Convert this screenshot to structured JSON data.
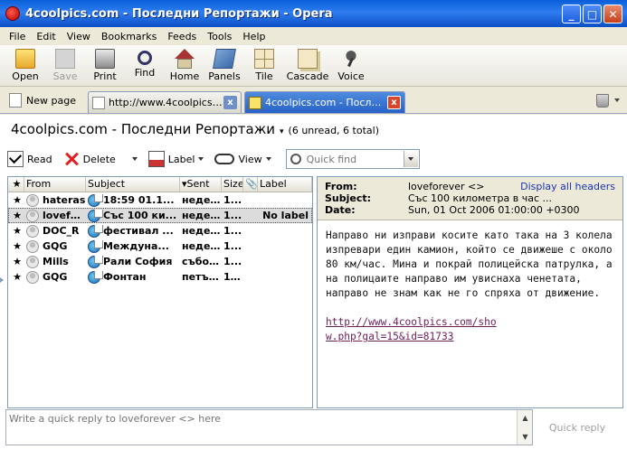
{
  "window": {
    "title": "4coolpics.com - Последни Репортажи - Opera",
    "controls": {
      "minimize": "_",
      "maximize": "□",
      "close": "✕"
    }
  },
  "menu": [
    "File",
    "Edit",
    "View",
    "Bookmarks",
    "Feeds",
    "Tools",
    "Help"
  ],
  "toolbar": {
    "open": "Open",
    "save": "Save",
    "print": "Print",
    "find": "Find",
    "home": "Home",
    "panels": "Panels",
    "tile": "Tile",
    "cascade": "Cascade",
    "voice": "Voice"
  },
  "tabs": {
    "new_page": "New page",
    "items": [
      {
        "label": "http://www.4coolpics.com/...",
        "active": false
      },
      {
        "label": "4coolpics.com - Последни Репортажи",
        "active": true
      }
    ],
    "close_glyph": "x"
  },
  "feed": {
    "title": "4coolpics.com - Последни Репортажи",
    "dropdown": "▾",
    "counts": "(6 unread, 6 total)"
  },
  "mail_toolbar": {
    "read": "Read",
    "delete": "Delete",
    "label": "Label",
    "view": "View",
    "quick_find_placeholder": "Quick find"
  },
  "list": {
    "columns": {
      "star": "★",
      "from": "From",
      "subject": "Subject",
      "sent": "Sent",
      "size": "Size",
      "attachment": "📎",
      "label": "Label"
    },
    "rows": [
      {
        "star": "★",
        "from": "hateras",
        "subject": "18:59 01.1...",
        "sent": "недел...",
        "size": "1...",
        "label": ""
      },
      {
        "star": "★",
        "from": "lovefo...",
        "subject": "Със 100 ки...",
        "sent": "недел...",
        "size": "1...",
        "label": "No label",
        "selected": true
      },
      {
        "star": "★",
        "from": "DOC_R",
        "subject": "фестивал ...",
        "sent": "недел...",
        "size": "1...",
        "label": ""
      },
      {
        "star": "★",
        "from": "GQG",
        "subject": "Междуна...",
        "sent": "недел...",
        "size": "1...",
        "label": ""
      },
      {
        "star": "★",
        "from": "Mills",
        "subject": "Рали София",
        "sent": "съботн...",
        "size": "1...",
        "label": ""
      },
      {
        "star": "★",
        "from": "GQG",
        "subject": "Фонтан",
        "sent": "петък...",
        "size": "10...",
        "label": ""
      }
    ]
  },
  "reader": {
    "from_label": "From:",
    "from": "loveforever <>",
    "subject_label": "Subject:",
    "subject": "Със 100 километра в час ...",
    "date_label": "Date:",
    "date": "Sun, 01 Oct 2006 01:00:00 +0300",
    "display_all_headers": "Display all headers",
    "body": "Направо ни изправи косите като така на 3 колела изпревари един камион, който се движеше с около 80 км/час. Мина и покрай полицейска патрулка, а на полицаите направо им увиснаха ченетата, направо не знам как не го спряха от движение.",
    "link": "http://www.4coolpics.com/show.php?gal=15&id=81733"
  },
  "quick_reply": {
    "placeholder": "Write a quick reply to loveforever <> here",
    "button": "Quick reply"
  }
}
